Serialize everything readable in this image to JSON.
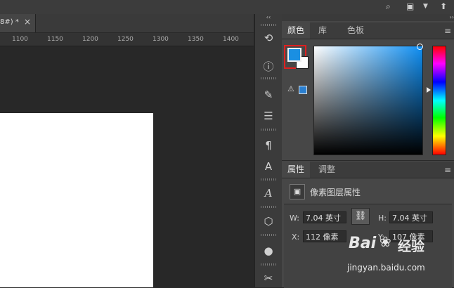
{
  "top_bar": {
    "icons": [
      "search-icon",
      "window-icon",
      "chevron-down-icon",
      "share-icon"
    ]
  },
  "document_tab": {
    "name": "8#) *",
    "close": "×"
  },
  "ruler": {
    "ticks": [
      "1100",
      "1150",
      "1200",
      "1250",
      "1300",
      "1350",
      "1400"
    ]
  },
  "dock": {
    "collapse_glyph": "‹‹",
    "buttons": [
      "history-icon",
      "info-icon",
      "brush-settings-icon",
      "adjustments-icon",
      "paragraph-icon",
      "character-icon",
      "glyphs-icon",
      "3d-icon",
      "user-icon",
      "paths-icon"
    ]
  },
  "color_panel": {
    "expand_glyph": "››",
    "tabs": [
      "颜色",
      "库",
      "色板"
    ],
    "active_tab": "颜色",
    "foreground_color": "#1a8fe2",
    "background_color": "#ffffff",
    "websafe_color": "#2a7fd0"
  },
  "properties_panel": {
    "tabs": [
      "属性",
      "调整"
    ],
    "active_tab": "属性",
    "title": "像素图层属性",
    "w_label": "W:",
    "w_value": "7.04 英寸",
    "h_label": "H:",
    "h_value": "7.04 英寸",
    "x_label": "X:",
    "x_value": "112 像素",
    "y_label": "Y:",
    "y_value": "107 像素"
  },
  "watermark": {
    "brand": "Bai",
    "brand2": "经验",
    "url": "jingyan.baidu.com"
  }
}
